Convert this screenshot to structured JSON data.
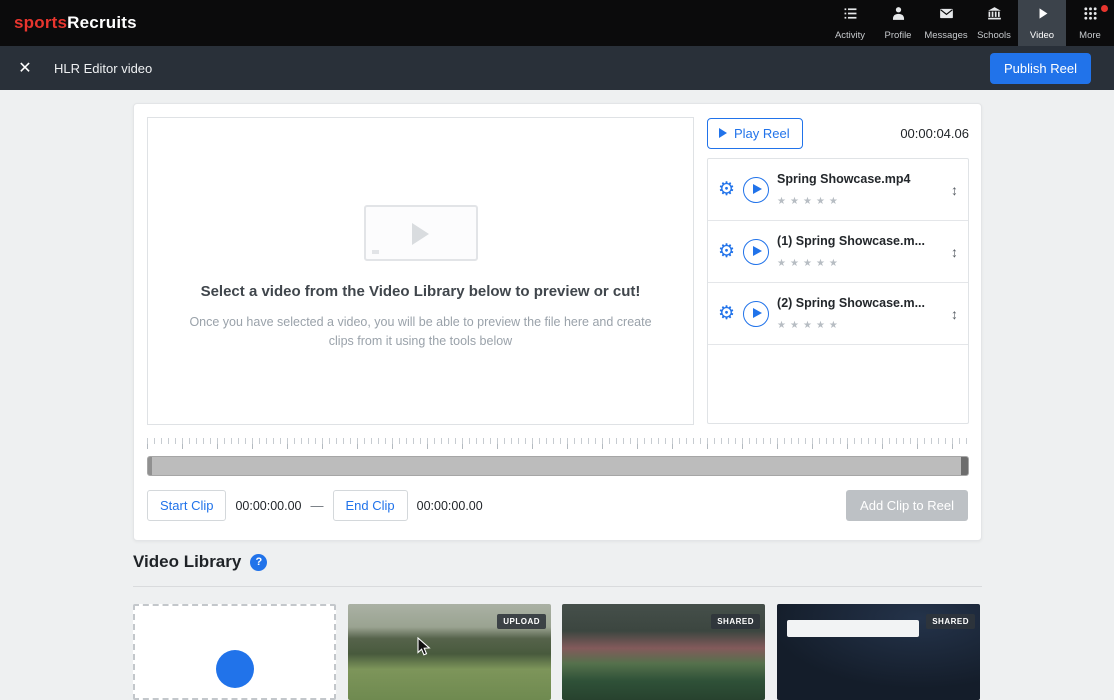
{
  "navbar": {
    "logo_sports": "sports",
    "logo_recruits": "Recruits",
    "items": [
      {
        "label": "Activity",
        "icon": "activity-icon",
        "active": false
      },
      {
        "label": "Profile",
        "icon": "profile-icon",
        "active": false
      },
      {
        "label": "Messages",
        "icon": "messages-icon",
        "active": false
      },
      {
        "label": "Schools",
        "icon": "schools-icon",
        "active": false
      },
      {
        "label": "Video",
        "icon": "video-icon",
        "active": true
      },
      {
        "label": "More",
        "icon": "more-grid-icon",
        "active": false,
        "notification_dot": true
      }
    ]
  },
  "subheader": {
    "title": "HLR Editor video",
    "publish_button_label": "Publish Reel"
  },
  "editor": {
    "preview_headline": "Select a video from the Video Library below to preview or cut!",
    "preview_subtext": "Once you have selected a video, you will be able to preview the file here and create clips from it using the tools below",
    "play_reel_label": "Play Reel",
    "reel_duration": "00:00:04.06",
    "clips": [
      {
        "title": "Spring Showcase.mp4",
        "rating_stars": 5
      },
      {
        "title": "(1) Spring Showcase.m...",
        "rating_stars": 5
      },
      {
        "title": "(2) Spring Showcase.m...",
        "rating_stars": 5
      }
    ],
    "controls": {
      "start_clip_label": "Start Clip",
      "start_time": "00:00:00.00",
      "separator": "—",
      "end_clip_label": "End Clip",
      "end_time": "00:00:00.00",
      "add_clip_label": "Add Clip to Reel"
    }
  },
  "library": {
    "title": "Video Library",
    "thumbnails": [
      {
        "kind": "upload-dropzone",
        "badge": ""
      },
      {
        "kind": "video",
        "badge": "UPLOAD"
      },
      {
        "kind": "video",
        "badge": "SHARED"
      },
      {
        "kind": "video",
        "badge": "SHARED"
      }
    ]
  },
  "colors": {
    "accent_blue": "#2173EA",
    "brand_red": "#E8352E",
    "navbar_black": "#0B0B0C",
    "subheader_slate": "#293039",
    "disabled_gray": "#BDC1C5"
  }
}
